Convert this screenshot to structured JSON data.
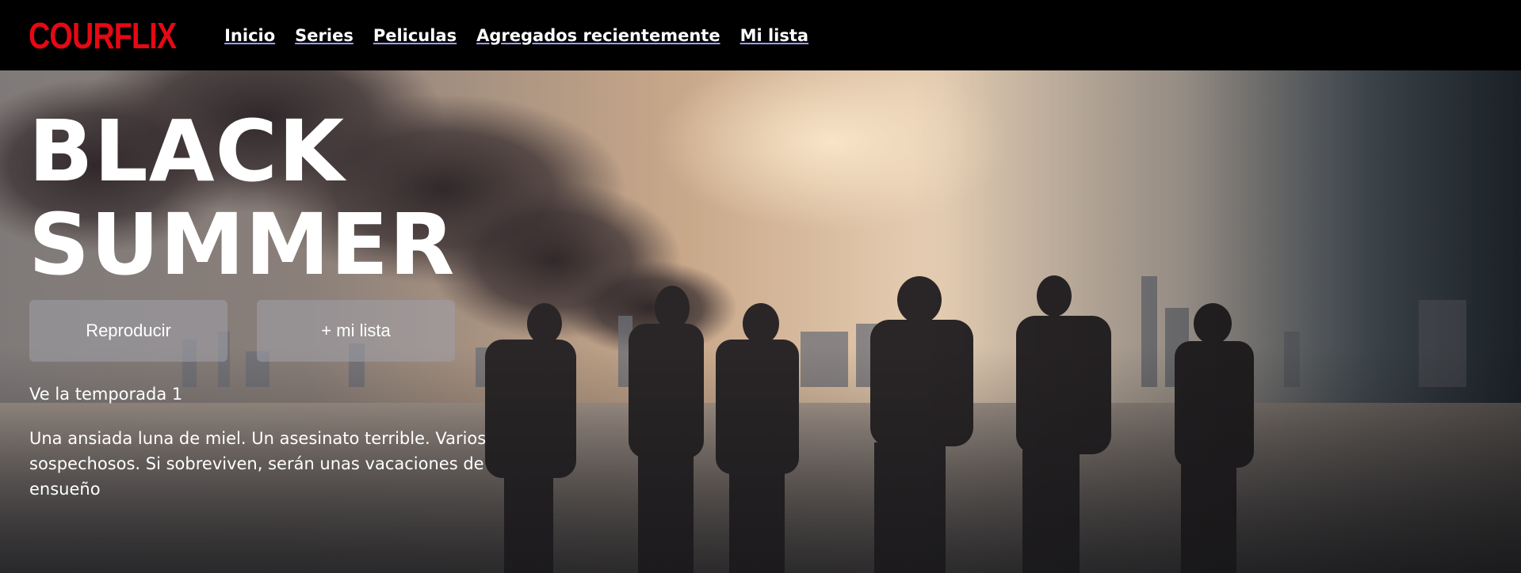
{
  "brand": {
    "logo": "COURFLIX",
    "color": "#e50914"
  },
  "nav": {
    "items": [
      {
        "label": "Inicio"
      },
      {
        "label": "Series"
      },
      {
        "label": "Peliculas"
      },
      {
        "label": "Agregados recientemente"
      },
      {
        "label": "Mi lista"
      }
    ]
  },
  "hero": {
    "title_line1": "BLACK",
    "title_line2": "SUMMER",
    "play_label": "Reproducir",
    "add_list_label": "+ mi lista",
    "season_text": "Ve la temporada 1",
    "synopsis": "Una ansiada luna de miel. Un asesinato terrible. Varios sospechosos. Si sobreviven, serán unas vacaciones de ensueño"
  }
}
